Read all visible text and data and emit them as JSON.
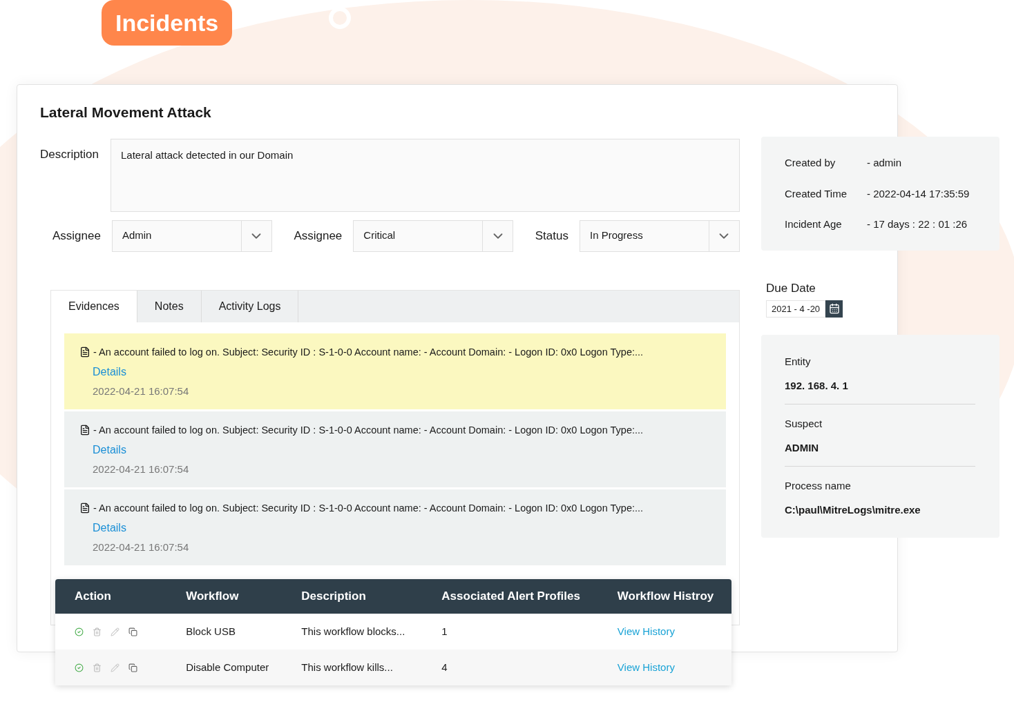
{
  "page_badge": "Incidents",
  "incident": {
    "title": "Lateral Movement Attack",
    "description_label": "Description",
    "description": "Lateral attack detected in our Domain"
  },
  "dropdowns": [
    {
      "label": "Assignee",
      "value": "Admin"
    },
    {
      "label": "Assignee",
      "value": "Critical"
    },
    {
      "label": "Status",
      "value": "In Progress"
    }
  ],
  "tabs": [
    {
      "label": "Evidences",
      "selected": true
    },
    {
      "label": "Notes",
      "selected": false
    },
    {
      "label": "Activity Logs",
      "selected": false
    }
  ],
  "evidences": [
    {
      "text": "- An account failed to log on. Subject: Security ID : S-1-0-0 Account name: - Account Domain: - Logon ID: 0x0 Logon Type:...",
      "link": "Details",
      "time": "2022-04-21 16:07:54",
      "selected": true
    },
    {
      "text": "- An account failed to log on. Subject: Security ID : S-1-0-0 Account name: - Account Domain: - Logon ID: 0x0 Logon Type:...",
      "link": "Details",
      "time": "2022-04-21 16:07:54",
      "selected": false
    },
    {
      "text": "- An account failed to log on. Subject: Security ID : S-1-0-0 Account name: - Account Domain: - Logon ID: 0x0 Logon Type:...",
      "link": "Details",
      "time": "2022-04-21 16:07:54",
      "selected": false
    }
  ],
  "info": [
    {
      "label": "Created by",
      "value": "- admin"
    },
    {
      "label": "Created Time",
      "value": "- 2022-04-14 17:35:59"
    },
    {
      "label": "Incident Age",
      "value": "- 17 days : 22 : 01 :26"
    }
  ],
  "due_date": {
    "label": "Due Date",
    "value": "2021 - 4 -20"
  },
  "details": [
    {
      "label": "Entity",
      "value": "192. 168. 4. 1"
    },
    {
      "label": "Suspect",
      "value": "ADMIN"
    },
    {
      "label": "Process name",
      "value": "C:\\paul\\MitreLogs\\mitre.exe"
    }
  ],
  "workflow_table": {
    "columns": [
      "Action",
      "Workflow",
      "Description",
      "Associated Alert Profiles",
      "Workflow Histroy"
    ],
    "rows": [
      {
        "workflow": "Block USB",
        "description": "This workflow blocks...",
        "profiles": "1",
        "history": "View History"
      },
      {
        "workflow": "Disable Computer",
        "description": "This workflow kills...",
        "profiles": "4",
        "history": "View History"
      }
    ]
  }
}
